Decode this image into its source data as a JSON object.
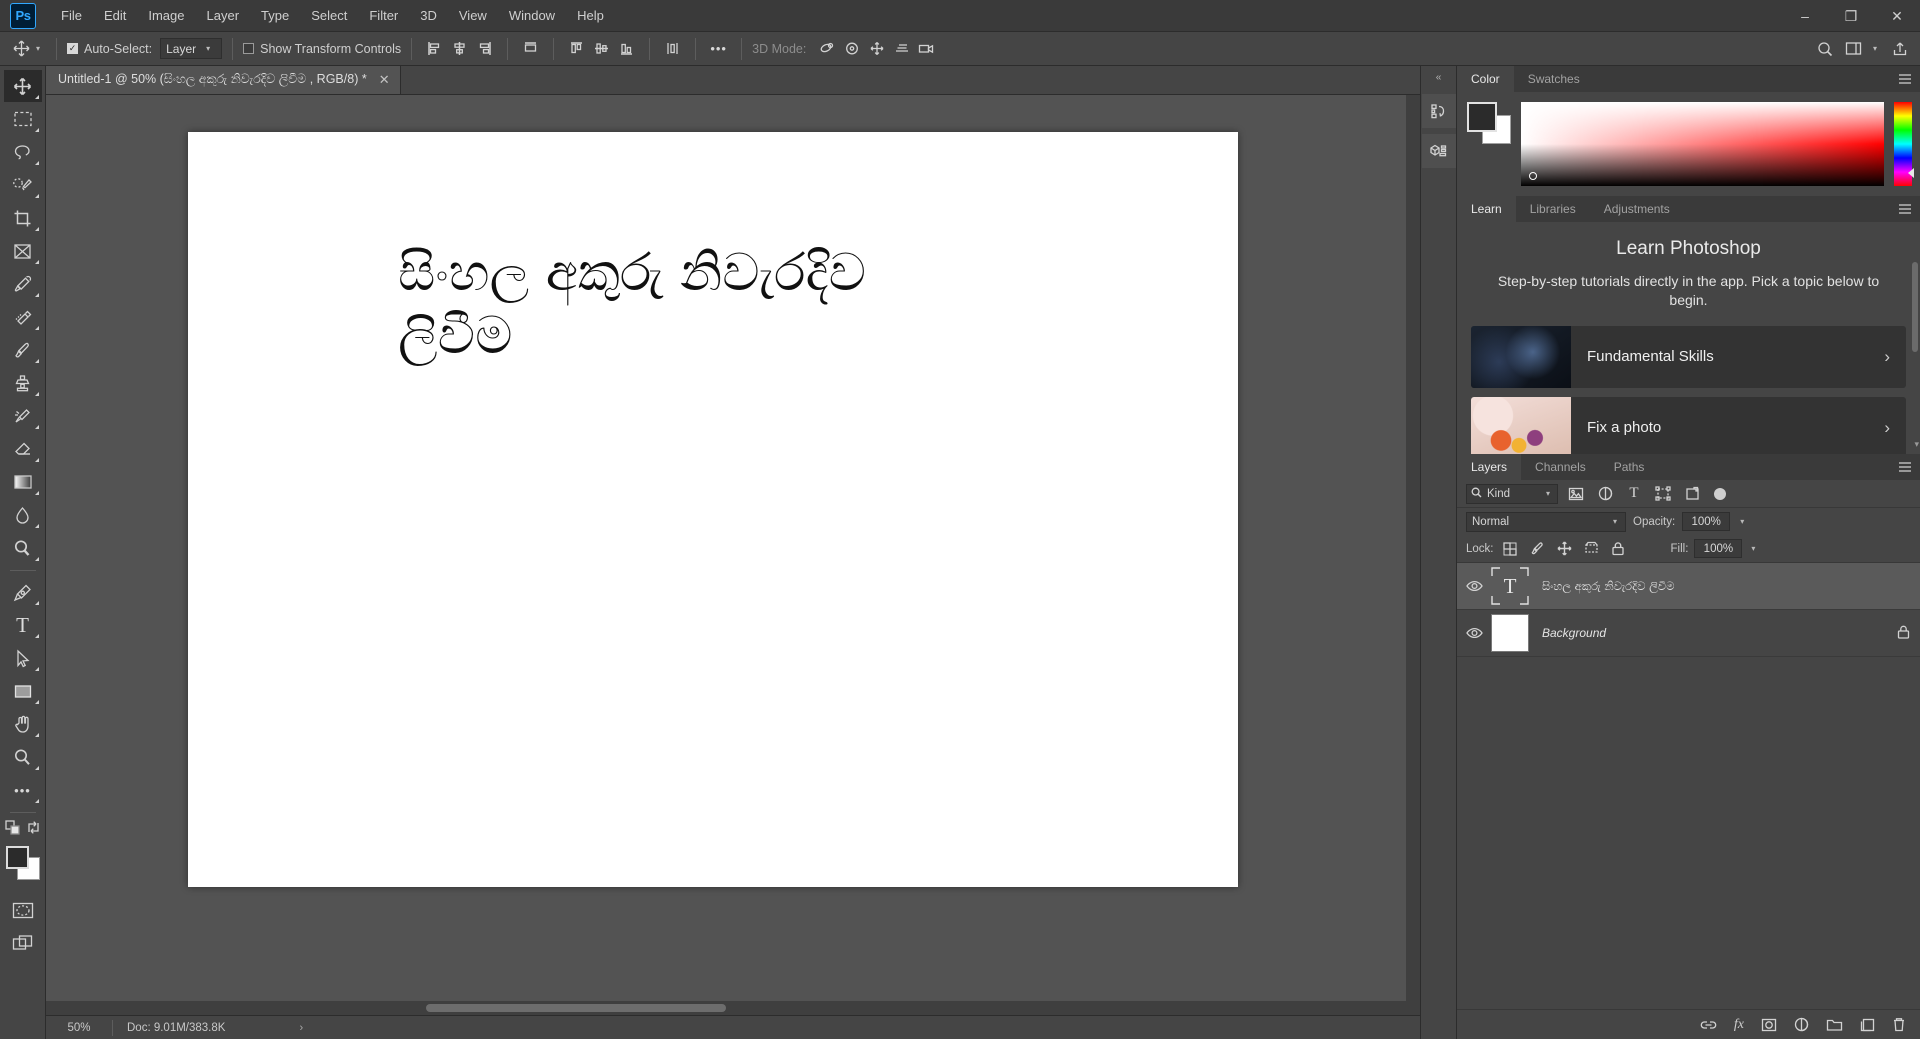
{
  "app": {
    "logo": "Ps",
    "name": "Adobe Photoshop"
  },
  "menubar": {
    "items": [
      "File",
      "Edit",
      "Image",
      "Layer",
      "Type",
      "Select",
      "Filter",
      "3D",
      "View",
      "Window",
      "Help"
    ]
  },
  "window_controls": {
    "minimize": "–",
    "maximize": "❐",
    "close": "✕"
  },
  "options_bar": {
    "tool_icon": "move-tool-icon",
    "auto_select_label": "Auto-Select:",
    "auto_select_checked": true,
    "auto_select_value": "Layer",
    "show_transform_label": "Show Transform Controls",
    "show_transform_checked": false,
    "more_label": "•••",
    "three_d_mode_label": "3D Mode:"
  },
  "toolbar": {
    "tools": [
      {
        "name": "move-tool",
        "active": true
      },
      {
        "name": "rectangular-marquee-tool",
        "active": false
      },
      {
        "name": "lasso-tool",
        "active": false
      },
      {
        "name": "quick-selection-tool",
        "active": false
      },
      {
        "name": "crop-tool",
        "active": false
      },
      {
        "name": "frame-tool",
        "active": false
      },
      {
        "name": "eyedropper-tool",
        "active": false
      },
      {
        "name": "spot-healing-brush-tool",
        "active": false
      },
      {
        "name": "brush-tool",
        "active": false
      },
      {
        "name": "clone-stamp-tool",
        "active": false
      },
      {
        "name": "history-brush-tool",
        "active": false
      },
      {
        "name": "eraser-tool",
        "active": false
      },
      {
        "name": "gradient-tool",
        "active": false
      },
      {
        "name": "blur-tool",
        "active": false
      },
      {
        "name": "dodge-tool",
        "active": false
      },
      {
        "name": "pen-tool",
        "active": false
      },
      {
        "name": "horizontal-type-tool",
        "active": false
      },
      {
        "name": "path-selection-tool",
        "active": false
      },
      {
        "name": "rectangle-tool",
        "active": false
      },
      {
        "name": "hand-tool",
        "active": false
      },
      {
        "name": "zoom-tool",
        "active": false
      },
      {
        "name": "edit-toolbar-tool",
        "active": false
      }
    ],
    "foreground_color": "#2b2b2b",
    "background_color": "#ffffff"
  },
  "document": {
    "tab_title": "Untitled-1 @ 50% (සිංහල අකුරු නිවැරදිව ලිවීම , RGB/8) *",
    "close_icon": "✕",
    "canvas_text": "සිංහල අකුරු නිවැරදිව ලිවීම",
    "canvas_background": "#ffffff"
  },
  "status_bar": {
    "zoom": "50%",
    "doc_info": "Doc: 9.01M/383.8K",
    "arrow": "›"
  },
  "rail": {
    "collapse_icon": "«",
    "buttons": [
      "history-panel-icon",
      "3d-panel-icon"
    ]
  },
  "color_panel": {
    "tabs": [
      {
        "label": "Color",
        "active": true
      },
      {
        "label": "Swatches",
        "active": false
      }
    ],
    "menu_icon": "panel-menu-icon",
    "foreground": "#2b2b2b",
    "background": "#ffffff"
  },
  "learn_panel": {
    "tabs": [
      {
        "label": "Learn",
        "active": true
      },
      {
        "label": "Libraries",
        "active": false
      },
      {
        "label": "Adjustments",
        "active": false
      }
    ],
    "menu_icon": "panel-menu-icon",
    "title": "Learn Photoshop",
    "subtitle": "Step-by-step tutorials directly in the app. Pick a topic below to begin.",
    "cards": [
      {
        "label": "Fundamental Skills",
        "arrow": "›"
      },
      {
        "label": "Fix a photo",
        "arrow": "›"
      }
    ]
  },
  "layers_panel": {
    "tabs": [
      {
        "label": "Layers",
        "active": true
      },
      {
        "label": "Channels",
        "active": false
      },
      {
        "label": "Paths",
        "active": false
      }
    ],
    "menu_icon": "panel-menu-icon",
    "filter": {
      "kind_label": "Kind",
      "search_icon": "search-icon",
      "chevron": "∨",
      "icons": [
        "filter-pixel-icon",
        "filter-adjustment-icon",
        "filter-type-icon",
        "filter-shape-icon",
        "filter-smart-object-icon"
      ]
    },
    "blend_mode": "Normal",
    "blend_chevron": "∨",
    "opacity_label": "Opacity:",
    "opacity_value": "100%",
    "lock_label": "Lock:",
    "lock_icons": [
      "lock-transparent-pixels-icon",
      "lock-image-pixels-icon",
      "lock-position-icon",
      "lock-artboard-icon",
      "lock-all-icon"
    ],
    "fill_label": "Fill:",
    "fill_value": "100%",
    "layers": [
      {
        "name": "සිංහල අකුරු නිවැරදිව ලිවීම",
        "type": "text",
        "thumb_glyph": "T",
        "visible": true,
        "selected": true,
        "locked": false,
        "italic": false
      },
      {
        "name": "Background",
        "type": "image",
        "thumb_glyph": "",
        "visible": true,
        "selected": false,
        "locked": true,
        "italic": true
      }
    ],
    "footer_icons": [
      "link-layers-icon",
      "layer-style-fx-icon",
      "add-layer-mask-icon",
      "new-adjustment-layer-icon",
      "new-group-icon",
      "new-layer-icon",
      "delete-layer-icon"
    ],
    "fx_label": "fx"
  },
  "colors": {
    "chrome": "#454545",
    "chrome_dark": "#3a3a3a",
    "canvas_backdrop": "#535353",
    "accent": "#31a8ff",
    "text": "#d4d4d4"
  }
}
